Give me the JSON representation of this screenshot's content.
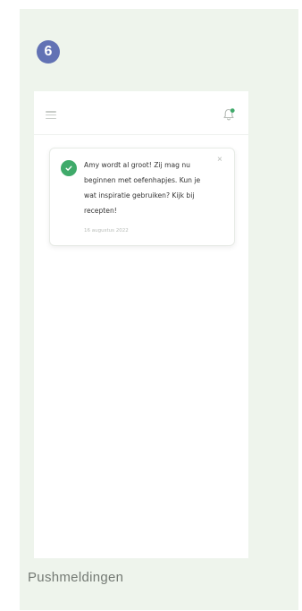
{
  "step": {
    "number": "6"
  },
  "icons": {
    "menu": "hamburger-icon",
    "notifications": "bell-icon",
    "success": "check-circle-icon",
    "close": "close-icon"
  },
  "colors": {
    "panel_background": "#eef4ec",
    "step_badge": "#6272b4",
    "success_green": "#3faa6a",
    "bell_dot": "#3faa6a"
  },
  "notification": {
    "message": "Amy wordt al groot! Zij mag nu beginnen met oefenhapjes. Kun je wat inspiratie gebruiken? Kijk bij recepten!",
    "date": "16 augustus 2022",
    "close_label": "×"
  },
  "caption": "Pushmeldingen"
}
